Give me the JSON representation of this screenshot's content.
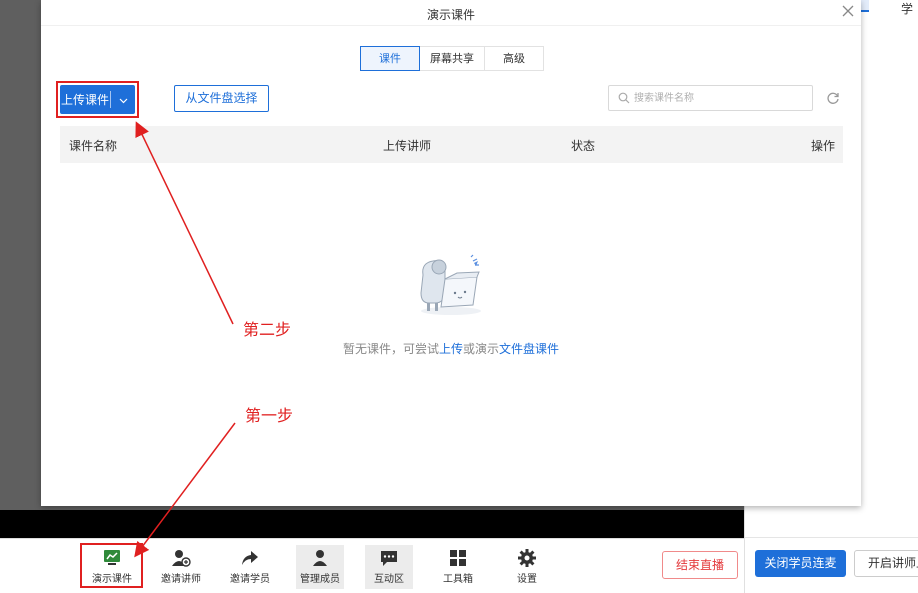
{
  "modal": {
    "title": "演示课件",
    "tabs": [
      {
        "label": "课件",
        "active": true
      },
      {
        "label": "屏幕共享",
        "active": false
      },
      {
        "label": "高级",
        "active": false
      }
    ],
    "upload_label": "上传课件",
    "disk_select_label": "从文件盘选择",
    "search_placeholder": "搜索课件名称",
    "table_headers": [
      "课件名称",
      "上传讲师",
      "状态",
      "操作"
    ],
    "empty_prefix": "暂无课件，可尝试",
    "empty_link_upload": "上传",
    "empty_mid": "或演示",
    "empty_link_disk": "文件盘课件"
  },
  "annotations": {
    "step1": "第一步",
    "step2": "第二步",
    "color": "#e02020"
  },
  "toolbar": {
    "items": [
      {
        "label": "演示课件",
        "icon": "present-courseware-icon"
      },
      {
        "label": "邀请讲师",
        "icon": "invite-teacher-icon"
      },
      {
        "label": "邀请学员",
        "icon": "share-arrow-icon"
      },
      {
        "label": "管理成员",
        "icon": "member-icon"
      },
      {
        "label": "互动区",
        "icon": "chat-icon"
      },
      {
        "label": "工具箱",
        "icon": "grid-icon"
      },
      {
        "label": "设置",
        "icon": "gear-icon"
      }
    ],
    "end_live_label": "结束直播"
  },
  "right_panel": {
    "top_tab_partial": "学",
    "close_mic_label": "关闭学员连麦",
    "open_teacher_label": "开启讲师上"
  },
  "colors": {
    "accent": "#1e6fd9",
    "danger": "#e4393c"
  }
}
